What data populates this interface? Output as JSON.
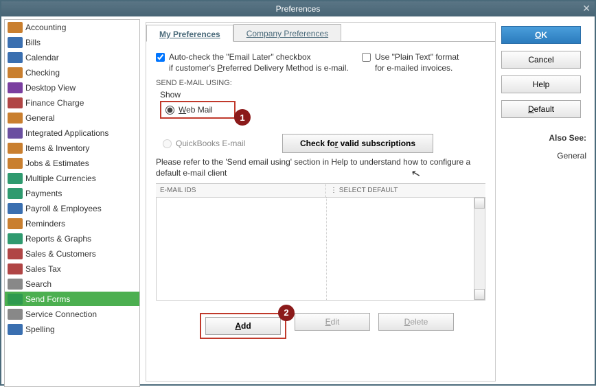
{
  "window": {
    "title": "Preferences"
  },
  "sidebar": {
    "items": [
      {
        "label": "Accounting",
        "icon": "#c97f2f",
        "selected": false
      },
      {
        "label": "Bills",
        "icon": "#3a6fb0",
        "selected": false
      },
      {
        "label": "Calendar",
        "icon": "#3a6fb0",
        "selected": false
      },
      {
        "label": "Checking",
        "icon": "#c97f2f",
        "selected": false
      },
      {
        "label": "Desktop View",
        "icon": "#7a3fa0",
        "selected": false
      },
      {
        "label": "Finance Charge",
        "icon": "#b04545",
        "selected": false
      },
      {
        "label": "General",
        "icon": "#c97f2f",
        "selected": false
      },
      {
        "label": "Integrated Applications",
        "icon": "#6a4fa0",
        "selected": false
      },
      {
        "label": "Items & Inventory",
        "icon": "#c97f2f",
        "selected": false
      },
      {
        "label": "Jobs & Estimates",
        "icon": "#c97f2f",
        "selected": false
      },
      {
        "label": "Multiple Currencies",
        "icon": "#2f9a6f",
        "selected": false
      },
      {
        "label": "Payments",
        "icon": "#2f9a6f",
        "selected": false
      },
      {
        "label": "Payroll & Employees",
        "icon": "#3a6fb0",
        "selected": false
      },
      {
        "label": "Reminders",
        "icon": "#c97f2f",
        "selected": false
      },
      {
        "label": "Reports & Graphs",
        "icon": "#2f9a6f",
        "selected": false
      },
      {
        "label": "Sales & Customers",
        "icon": "#b04545",
        "selected": false
      },
      {
        "label": "Sales Tax",
        "icon": "#b04545",
        "selected": false
      },
      {
        "label": "Search",
        "icon": "#888888",
        "selected": false
      },
      {
        "label": "Send Forms",
        "icon": "#2f9a4f",
        "selected": true
      },
      {
        "label": "Service Connection",
        "icon": "#888888",
        "selected": false
      },
      {
        "label": "Spelling",
        "icon": "#3a6fb0",
        "selected": false
      }
    ]
  },
  "tabs": {
    "my": "My Preferences",
    "company": "Company Preferences"
  },
  "checks": {
    "auto_line1": "Auto-check the \"Email Later\" checkbox",
    "auto_line2a": "if customer's ",
    "auto_line2b": "P",
    "auto_line2c": "referred Delivery Method is e-mail.",
    "plain_line1": "Use \"Plain Text\" format",
    "plain_line2": "for e-mailed invoices."
  },
  "section": {
    "send_using": "SEND E-MAIL USING:",
    "show": "Show",
    "web_u": "W",
    "web_rest": "eb Mail",
    "qb_email": "QuickBooks E-mail",
    "check_valid_a": "Check fo",
    "check_valid_u": "r",
    "check_valid_b": " valid subscriptions",
    "help_text": "Please refer to the 'Send email using' section in Help to understand how to configure a default e-mail client",
    "col_email": "E-MAIL IDS",
    "col_default": "SELECT DEFAULT"
  },
  "buttons": {
    "add_u": "A",
    "add_rest": "dd",
    "edit_u": "E",
    "edit_rest": "dit",
    "del_u": "D",
    "del_rest": "elete"
  },
  "right": {
    "ok_u": "O",
    "ok_rest": "K",
    "cancel": "Cancel",
    "help": "Help",
    "default_u": "D",
    "default_rest": "efault",
    "also_see": "Also See:",
    "general": "General"
  },
  "callouts": {
    "one": "1",
    "two": "2"
  }
}
